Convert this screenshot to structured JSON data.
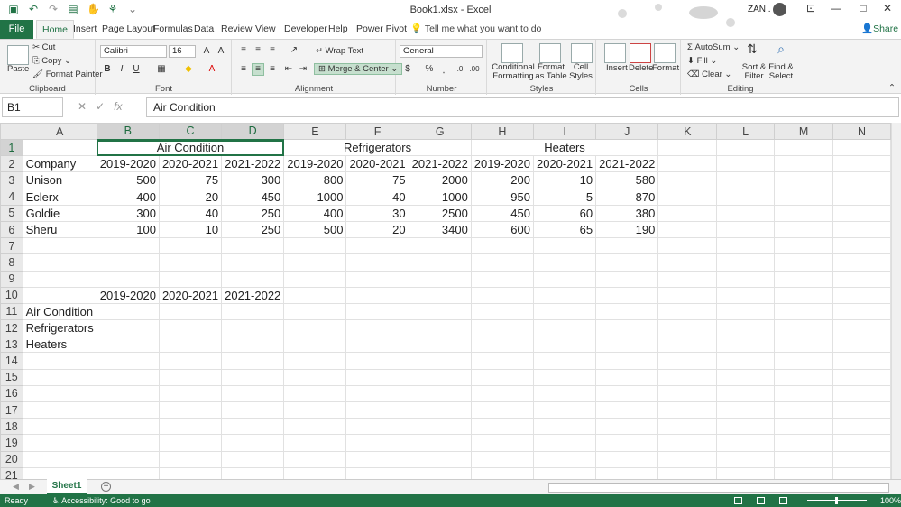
{
  "window": {
    "title": "Book1.xlsx  -  Excel",
    "user": "ZAN .",
    "controls": [
      "—",
      "□",
      "✕"
    ]
  },
  "ribbon_tabs": [
    "File",
    "Home",
    "Insert",
    "Page Layout",
    "Formulas",
    "Data",
    "Review",
    "View",
    "Developer",
    "Help",
    "Power Pivot"
  ],
  "tell_me": "Tell me what you want to do",
  "share": "Share",
  "clipboard": {
    "paste": "Paste",
    "cut": "Cut",
    "copy": "Copy",
    "format_painter": "Format Painter",
    "label": "Clipboard"
  },
  "font": {
    "name": "Calibri",
    "size": "16",
    "label": "Font",
    "bold": "B",
    "italic": "I",
    "underline": "U"
  },
  "alignment": {
    "wrap_text": "Wrap Text",
    "merge_center": "Merge & Center",
    "label": "Alignment"
  },
  "number": {
    "format": "General",
    "label": "Number",
    "currency": "$",
    "percent": "%",
    "comma": "͙"
  },
  "styles": {
    "conditional": "Conditional Formatting",
    "format_table": "Format as Table",
    "cell_styles": "Cell Styles",
    "label": "Styles"
  },
  "cells": {
    "insert": "Insert",
    "delete": "Delete",
    "format": "Format",
    "label": "Cells"
  },
  "editing": {
    "autosum": "AutoSum",
    "fill": "Fill",
    "clear": "Clear",
    "sort_filter": "Sort & Filter",
    "find_select": "Find & Select",
    "label": "Editing"
  },
  "formula_bar": {
    "name_box": "B1",
    "content": "Air Condition"
  },
  "grid": {
    "columns": [
      "A",
      "B",
      "C",
      "D",
      "E",
      "F",
      "G",
      "H",
      "I",
      "J",
      "K",
      "L",
      "M",
      "N"
    ],
    "rows": [
      "1",
      "2",
      "3",
      "4",
      "5",
      "6",
      "7",
      "8",
      "9",
      "10",
      "11",
      "12",
      "13",
      "14",
      "15",
      "16",
      "17",
      "18",
      "19",
      "20",
      "21"
    ],
    "merged_headers": [
      "Air Condition",
      "Refrigerators",
      "Heaters"
    ],
    "header_row": [
      "Company",
      "2019-2020",
      "2020-2021",
      "2021-2022",
      "2019-2020",
      "2020-2021",
      "2021-2022",
      "2019-2020",
      "2020-2021",
      "2021-2022"
    ],
    "data_rows": [
      [
        "Unison",
        "500",
        "75",
        "300",
        "800",
        "75",
        "2000",
        "200",
        "10",
        "580"
      ],
      [
        "Eclerx",
        "400",
        "20",
        "450",
        "1000",
        "40",
        "1000",
        "950",
        "5",
        "870"
      ],
      [
        "Goldie",
        "300",
        "40",
        "250",
        "400",
        "30",
        "2500",
        "450",
        "60",
        "380"
      ],
      [
        "Sheru",
        "100",
        "10",
        "250",
        "500",
        "20",
        "3400",
        "600",
        "65",
        "190"
      ]
    ],
    "row10": [
      "",
      "2019-2020",
      "2020-2021",
      "2021-2022"
    ],
    "row_labels": [
      "Air Condition",
      "Refrigerators",
      "Heaters"
    ]
  },
  "sheet_tab": "Sheet1",
  "status": {
    "ready": "Ready",
    "accessibility": "Accessibility: Good to go",
    "zoom": "100%"
  }
}
